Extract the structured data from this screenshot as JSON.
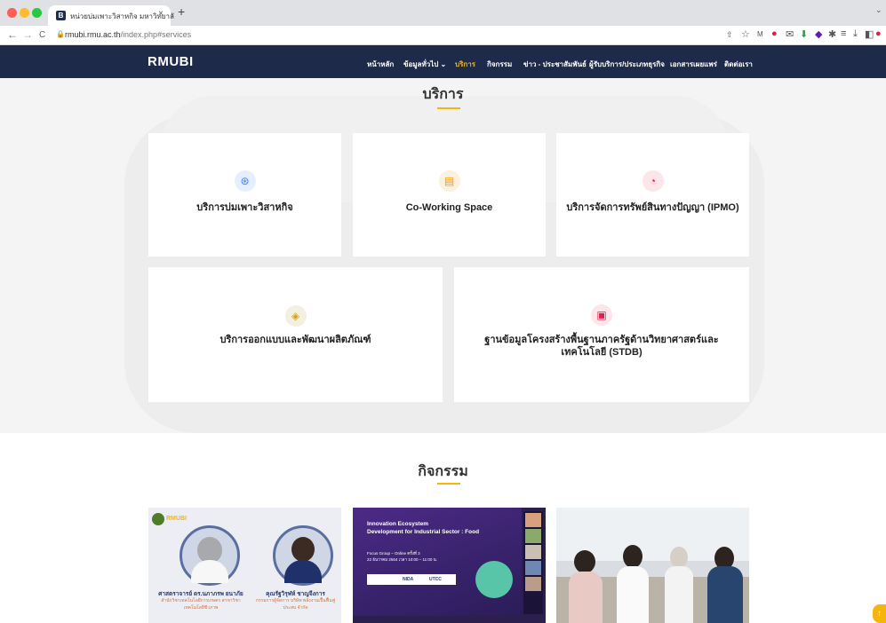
{
  "browser": {
    "tab_title": "หน่วยบ่มเพาะวิสาหกิจ มหาวิทยาลั",
    "tab_favicon": "B",
    "url_host": "rmubi.rmu.ac.th",
    "url_path": "/index.php#services"
  },
  "site": {
    "logo": "RMUBI",
    "nav": [
      "หน้าหลัก",
      "ข้อมูลทั่วไป ⌄",
      "บริการ",
      "กิจกรรม",
      "ข่าว - ประชาสัมพันธ์",
      "ผู้รับบริการ/ประเภทธุรกิจ",
      "เอกสารเผยแพร่",
      "ติดต่อเรา"
    ],
    "active_nav": "บริการ"
  },
  "services": {
    "title": "บริการ",
    "cards": [
      {
        "label": "บริการบ่มเพาะวิสาหกิจ",
        "icon": "dribbble-icon",
        "icon_color": "#3b82f6",
        "icon_bg": "#e6efff"
      },
      {
        "label": "Co-Working Space",
        "icon": "file-icon",
        "icon_color": "#f59e0b",
        "icon_bg": "#fdf0dc"
      },
      {
        "label": "บริการจัดการทรัพย์สินทางปัญญา (IPMO)",
        "icon": "speedometer-icon",
        "icon_color": "#e11d48",
        "icon_bg": "#fde6ea"
      },
      {
        "label": "บริการออกแบบและพัฒนาผลิตภัณฑ์",
        "icon": "layers-icon",
        "icon_color": "#d6a21e",
        "icon_bg": "#f3efe3"
      },
      {
        "label": "ฐานข้อมูลโครงสร้างพื้นฐานภาครัฐด้านวิทยาศาสตร์และเทคโนโลยี (STDB)",
        "icon": "slideshow-icon",
        "icon_color": "#e11d48",
        "icon_bg": "#fde6ea"
      }
    ]
  },
  "activities": {
    "title": "กิจกรรม",
    "images": [
      {
        "badge": "RMUBI",
        "person1_name": "ศาสตราจารย์ ดร.นภาภรพ ยนาภัย",
        "person1_role": "สำนักวิชาเทคโนโลยีการเกษตร สาขาวิชาเทคโนโลยีชีวภาพ",
        "person2_name": "คุณรัฐวิรุฬห์ ชาญจีงการ",
        "person2_role": "กรรมการผู้จัดการ บริษัท พลังงานเปื้นฟื้นฟูประสบ จำกัด"
      },
      {
        "title_line1": "Innovation Ecosystem",
        "title_line2": "Development for Industrial Sector : Food",
        "detail_line1": "Focus Group – Online ครั้งที่ 3",
        "detail_line2": "22 ธันวาคม 2564 เวลา 10:00 – 11:00 น.",
        "logos": [
          "NIDA",
          "UTCC"
        ]
      },
      {
        "kind": "photo"
      }
    ]
  }
}
